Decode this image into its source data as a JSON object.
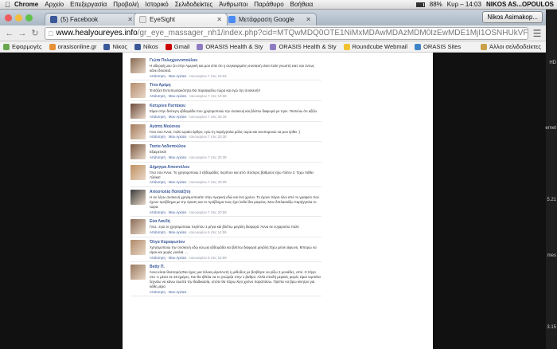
{
  "menubar": {
    "app": "Chrome",
    "items": [
      "Αρχείο",
      "Επεξεργασία",
      "Προβολή",
      "Ιστορικό",
      "Σελιδοδείκτες",
      "Άνθρωποι",
      "Παράθυρο",
      "Βοήθεια"
    ],
    "battery": "88%",
    "clock": "Κυρ – 14:03",
    "user": "NIKOS AS...OPOULOS"
  },
  "tabs": [
    {
      "label": "(5) Facebook",
      "color": "#3b5998",
      "active": false
    },
    {
      "label": "EyeSight",
      "color": "#e8e8e8",
      "active": true
    },
    {
      "label": "Μετάφραση Google",
      "color": "#4a8af4",
      "active": false
    }
  ],
  "profile_button": "Nikos Asimakop...",
  "address": {
    "host": "www.healyoureyes.info",
    "path": "/gr_eye_massager_nh1/index.php?cid=MTQwMDQ0OTE1NiMxMDAwMDAzMDM0IzEwMDE1MjI1OSNHUkVFQ0UjQXRoZW5z..."
  },
  "bookmarks": [
    {
      "label": "Εφαρμογές",
      "color": "#6aa84f"
    },
    {
      "label": "orasisonline.gr",
      "color": "#e69138"
    },
    {
      "label": "Νίκος",
      "color": "#3b5998"
    },
    {
      "label": "Nikos",
      "color": "#3b5998"
    },
    {
      "label": "Gmail",
      "color": "#cc0000"
    },
    {
      "label": "ORASIS Health & Sty",
      "color": "#8e7cc3"
    },
    {
      "label": "ORASIS Health & Sty",
      "color": "#8e7cc3"
    },
    {
      "label": "Roundcube Webmail",
      "color": "#f1c232"
    },
    {
      "label": "ORASIS Sites",
      "color": "#3d85c6"
    }
  ],
  "other_bookmarks": "Άλλοι σελιδοδείκτες",
  "comments": [
    {
      "name": "Γιώτα Πολυχρονοπούλου",
      "text": "Η αδερφή μου ζει στην Αμερική και μου είπε ότι η συγκεκριμένη συσκευή είναι πολύ γνωστή εκεί, και όντως κάνει δουλειά.",
      "time": "Ιανουαρίου 7 στις 19:53",
      "color": "#8a6a52"
    },
    {
      "name": "Τίνα Αρέμη",
      "text": "Έντάξει! Εντυπωσιακότητα.Θα παραγγείλω τώρα και εγώ την συσκευή!!",
      "time": "Ιανουαρίου 7 στις 19:58",
      "color": "#b58d6e"
    },
    {
      "name": "Κατερίνα Πιστάκου",
      "text": "Είμαι στην δεύτερη εβδομάδα που χρησιμοποιώ την συσκευή και βλέπω διαφορά με πριν. Πιστεύω ότι αξίζει.",
      "time": "Ιανουαρίου 7 στις 20:18",
      "color": "#6d4c3d"
    },
    {
      "name": "Αγάπη Μούσιου",
      "text": "Γεια σου Άννα, πολύ ωραίο άρθρο, εγώ τη παρήγγειλα μόλις τώρα και ανυπομονώ να μου έρθει :)",
      "time": "Ιανουαρίου 7 στις 20:38",
      "color": "#a47a5a"
    },
    {
      "name": "Τασία Λαδοπούλου",
      "text": "Εξαιρετικό!",
      "time": "Ιανουαρίου 7 στις 20:39",
      "color": "#7d5d45"
    },
    {
      "name": "Δήμητρα Αποστόλου",
      "text": "Γεια σου Άννα. Το χρησιμοποιώ 2 εβδομάδες περίπου και από τέσσερις βαθμούς έχω πλέον 2. Έχω πάθει πλάκα!",
      "time": "Ιανουαρίου 7 στις 20:39",
      "color": "#c09060"
    },
    {
      "name": "Αποστολία Παπαΐζίτη",
      "text": "Η αν λέγω συσκευή χρησιμοποιείτε στην Αμερική εδώ και ένα χρόνο. Το έχουν πάρει όλοι από το γραφείο που έχουν πρόβλημα με την όραση και το πρόβλημα τους έχει λυθεί δια μαγείας. Μου διπλασιάζω παρήγγειλα το τώρα.",
      "time": "Ιανουαρίου 7 στις 20:59",
      "color": "#3a3a3a"
    },
    {
      "name": "Εύα Λανδή",
      "text": "Γεια.. εγώ το χρησιμοποιώ περίπου 1 μήνα και βλέπω μεγάλη διαφορά. Άννα σε ευχαριστώ πολύ",
      "time": "Ιανουαρίου 6 στις 14:59",
      "color": "#8c6e58"
    },
    {
      "name": "Όλγα Καραφωτίου",
      "text": "Χρησιμοποιώ την συσκευή εδώ και μια εβδομάδα και βλέπω διαφορά μεγάλη.Έχω μείνει άφωνη. Μπορώ να είμαι και χωρίς γυαλιά. ...",
      "time": "Ιανουαρίου 6 στις 15:59",
      "color": "#b08a68"
    },
    {
      "name": "Betty Π.",
      "text": "Άννα είσαι θεσσαρός!Να έχεις μια τέλεια μέρα!Αυτή η μέθοδος με βοήθησε να ρίξω 2 μονάδες, από -3 πήγα στο -1 μέσα σε 28 ημέρες. Και θα ήθελα να το γνώριζα στην 1 βαθμό. Αλλά επειδή μερικές φορές είμαι τεμπέλα ξεχνάω να κάνω σωστά την διαδικασία, οπότε θα πάρω λίγο χρόνο παραπάνω. Πρέπει να βρω κίνητρο για κάθε μέρα",
      "time": "",
      "color": "#9b7b61"
    }
  ],
  "comment_actions": {
    "reply": "Απάντηση",
    "like": "Μου Αρέσει"
  },
  "dock_labels": [
    "HD",
    "ernet",
    "5.21",
    "mes",
    "3.15"
  ]
}
